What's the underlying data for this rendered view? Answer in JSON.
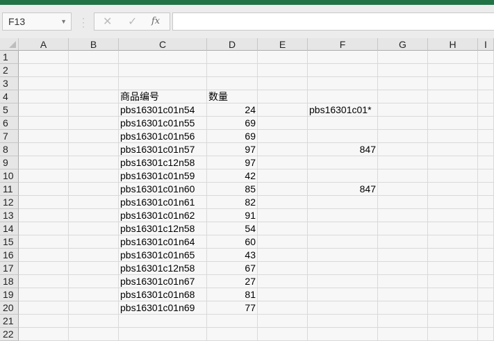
{
  "name_box": "F13",
  "formula_bar": {
    "cancel_icon": "✕",
    "enter_icon": "✓",
    "fx_label": "fx",
    "value": ""
  },
  "columns": [
    "A",
    "B",
    "C",
    "D",
    "E",
    "F",
    "G",
    "H",
    "I"
  ],
  "rows": [
    "1",
    "2",
    "3",
    "4",
    "5",
    "6",
    "7",
    "8",
    "9",
    "10",
    "11",
    "12",
    "13",
    "14",
    "15",
    "16",
    "17",
    "18",
    "19",
    "20",
    "21",
    "22"
  ],
  "cells": [
    {
      "r": 4,
      "c": "C",
      "v": "商品编号"
    },
    {
      "r": 4,
      "c": "D",
      "v": "数量"
    },
    {
      "r": 5,
      "c": "C",
      "v": "pbs16301c01n54"
    },
    {
      "r": 5,
      "c": "D",
      "v": "24",
      "num": true
    },
    {
      "r": 5,
      "c": "F",
      "v": "pbs16301c01*"
    },
    {
      "r": 6,
      "c": "C",
      "v": "pbs16301c01n55"
    },
    {
      "r": 6,
      "c": "D",
      "v": "69",
      "num": true
    },
    {
      "r": 7,
      "c": "C",
      "v": "pbs16301c01n56"
    },
    {
      "r": 7,
      "c": "D",
      "v": "69",
      "num": true
    },
    {
      "r": 8,
      "c": "C",
      "v": "pbs16301c01n57"
    },
    {
      "r": 8,
      "c": "D",
      "v": "97",
      "num": true
    },
    {
      "r": 8,
      "c": "F",
      "v": "847",
      "num": true
    },
    {
      "r": 9,
      "c": "C",
      "v": "pbs16301c12n58"
    },
    {
      "r": 9,
      "c": "D",
      "v": "97",
      "num": true
    },
    {
      "r": 10,
      "c": "C",
      "v": "pbs16301c01n59"
    },
    {
      "r": 10,
      "c": "D",
      "v": "42",
      "num": true
    },
    {
      "r": 11,
      "c": "C",
      "v": "pbs16301c01n60"
    },
    {
      "r": 11,
      "c": "D",
      "v": "85",
      "num": true
    },
    {
      "r": 11,
      "c": "F",
      "v": "847",
      "num": true
    },
    {
      "r": 12,
      "c": "C",
      "v": "pbs16301c01n61"
    },
    {
      "r": 12,
      "c": "D",
      "v": "82",
      "num": true
    },
    {
      "r": 13,
      "c": "C",
      "v": "pbs16301c01n62"
    },
    {
      "r": 13,
      "c": "D",
      "v": "91",
      "num": true
    },
    {
      "r": 14,
      "c": "C",
      "v": "pbs16301c12n58"
    },
    {
      "r": 14,
      "c": "D",
      "v": "54",
      "num": true
    },
    {
      "r": 15,
      "c": "C",
      "v": "pbs16301c01n64"
    },
    {
      "r": 15,
      "c": "D",
      "v": "60",
      "num": true
    },
    {
      "r": 16,
      "c": "C",
      "v": "pbs16301c01n65"
    },
    {
      "r": 16,
      "c": "D",
      "v": "43",
      "num": true
    },
    {
      "r": 17,
      "c": "C",
      "v": "pbs16301c12n58"
    },
    {
      "r": 17,
      "c": "D",
      "v": "67",
      "num": true
    },
    {
      "r": 18,
      "c": "C",
      "v": "pbs16301c01n67"
    },
    {
      "r": 18,
      "c": "D",
      "v": "27",
      "num": true
    },
    {
      "r": 19,
      "c": "C",
      "v": "pbs16301c01n68"
    },
    {
      "r": 19,
      "c": "D",
      "v": "81",
      "num": true
    },
    {
      "r": 20,
      "c": "C",
      "v": "pbs16301c01n69"
    },
    {
      "r": 20,
      "c": "D",
      "v": "77",
      "num": true
    }
  ]
}
